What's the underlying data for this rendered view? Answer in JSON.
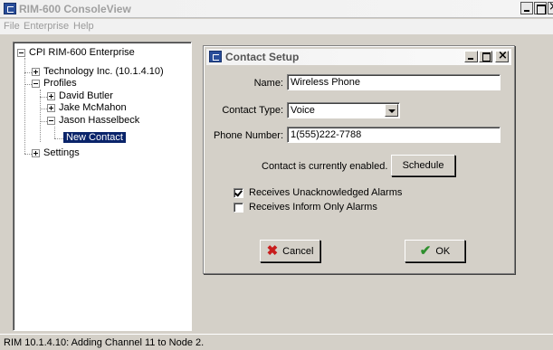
{
  "app": {
    "title": "RIM-600 ConsoleView",
    "menu": [
      "File",
      "Enterprise",
      "Help"
    ]
  },
  "tree": {
    "root": "CPI RIM-600 Enterprise",
    "technology": "Technology Inc. (10.1.4.10)",
    "profiles": "Profiles",
    "david": "David Butler",
    "jake": "Jake McMahon",
    "jason": "Jason Hasselbeck",
    "new_contact": "New Contact",
    "settings": "Settings"
  },
  "dialog": {
    "title": "Contact Setup",
    "name_label": "Name:",
    "name_value": "Wireless Phone",
    "type_label": "Contact Type:",
    "type_value": "Voice",
    "phone_label": "Phone Number:",
    "phone_value": "1(555)222-7788",
    "status_text": "Contact is currently enabled.",
    "schedule_label": "Schedule",
    "unack_label": "Receives Unacknowledged Alarms",
    "unack_checked": true,
    "inform_label": "Receives Inform Only Alarms",
    "inform_checked": false,
    "cancel_label": "Cancel",
    "ok_label": "OK"
  },
  "status": {
    "text": "RIM 10.1.4.10: Adding Channel 11 to Node 2."
  },
  "colors": {
    "selection": "#0a246a",
    "cancel_icon": "#c81d1d",
    "ok_icon": "#2e8f2e"
  }
}
